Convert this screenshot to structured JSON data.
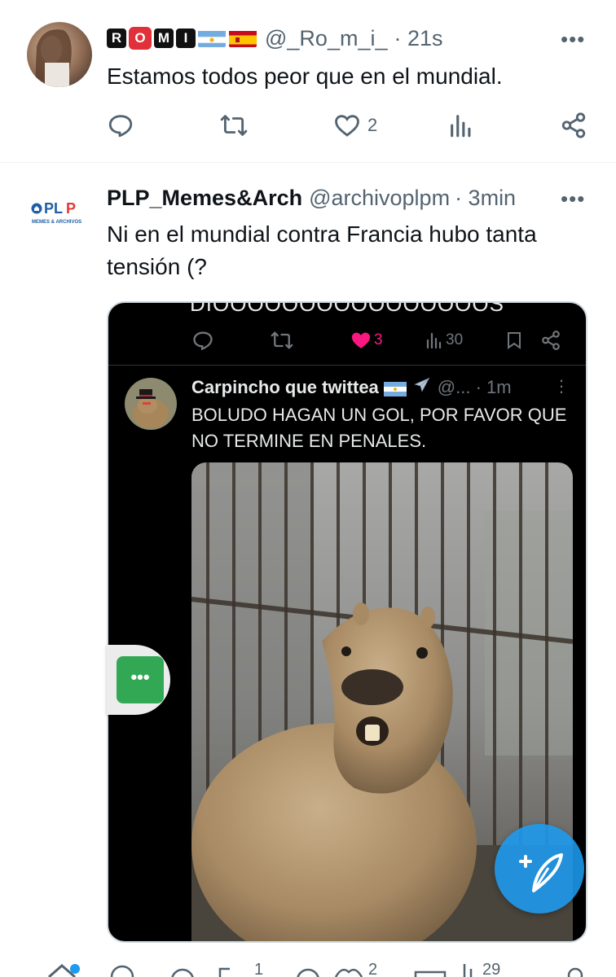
{
  "tweets": [
    {
      "handle": "@_Ro_m_i_",
      "name_letters": [
        "R",
        "O",
        "M",
        "I"
      ],
      "time": "· 21s",
      "text": "Estamos todos peor que en el mundial.",
      "actions": {
        "reply_count": "",
        "retweet_count": "",
        "like_count": "2"
      },
      "more": "•••"
    },
    {
      "display_name": "PLP_Memes&Arch",
      "handle": "@archivoplpm",
      "time": "· 3min",
      "avatar_logo": "PLP",
      "avatar_sub": "MEMES & ARCHIVOS",
      "text": "Ni en el mundial contra Francia hubo tanta tensión (?",
      "more": "•••",
      "embed": {
        "cut_text": "DIOOOOOOOOOOOOOOOOS",
        "actions": {
          "like_count": "3",
          "views": "30"
        },
        "name": "Carpincho que twittea",
        "meta": "@... · 1m",
        "text": "BOLUDO HAGAN UN GOL, POR FAVOR QUE NO TERMINE EN PENALES."
      }
    }
  ],
  "bottom_bar": {
    "retweet_count": "1",
    "like_count": "2",
    "views": "29"
  },
  "side_tab": {
    "icon": "more-dots-icon",
    "label": "•••"
  },
  "fab": {
    "icon": "compose-icon"
  },
  "colors": {
    "accent": "#1d9bf0",
    "text": "#0f1419",
    "muted": "#536471",
    "like": "#f91880",
    "green": "#33a854"
  }
}
